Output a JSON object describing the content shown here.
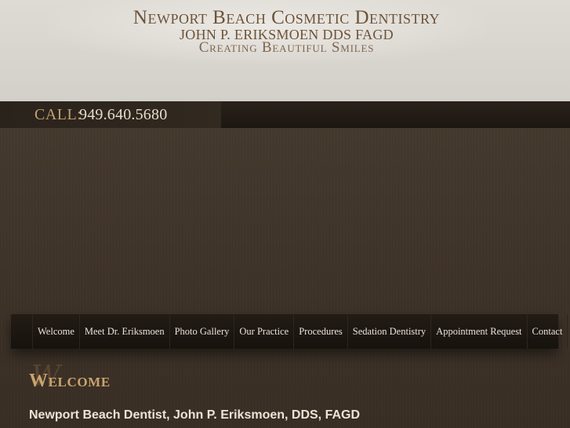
{
  "header": {
    "title": "Newport Beach Cosmetic Dentistry",
    "subtitle": "JOHN P. ERIKSMOEN DDS FAGD",
    "tagline": "Creating Beautiful Smiles"
  },
  "call_bar": {
    "label": "CALL:",
    "phone": "949.640.5680"
  },
  "nav": {
    "items": [
      {
        "label": "Welcome"
      },
      {
        "label": "Meet Dr. Eriksmoen"
      },
      {
        "label": "Photo Gallery"
      },
      {
        "label": "Our Practice"
      },
      {
        "label": "Procedures"
      },
      {
        "label": "Sedation Dentistry"
      },
      {
        "label": "Appointment Request"
      },
      {
        "label": "Contact"
      }
    ]
  },
  "content": {
    "welcome_script": "W",
    "heading": "Welcome",
    "subheading": "Newport Beach Dentist, John P. Eriksmoen, DDS, FAGD"
  },
  "colors": {
    "header_bg": "#d8d4ce",
    "title_brown": "#6b5338",
    "gold_accent": "#c9a46e",
    "body_bg": "#3f3328",
    "nav_bg": "#1c1712"
  }
}
